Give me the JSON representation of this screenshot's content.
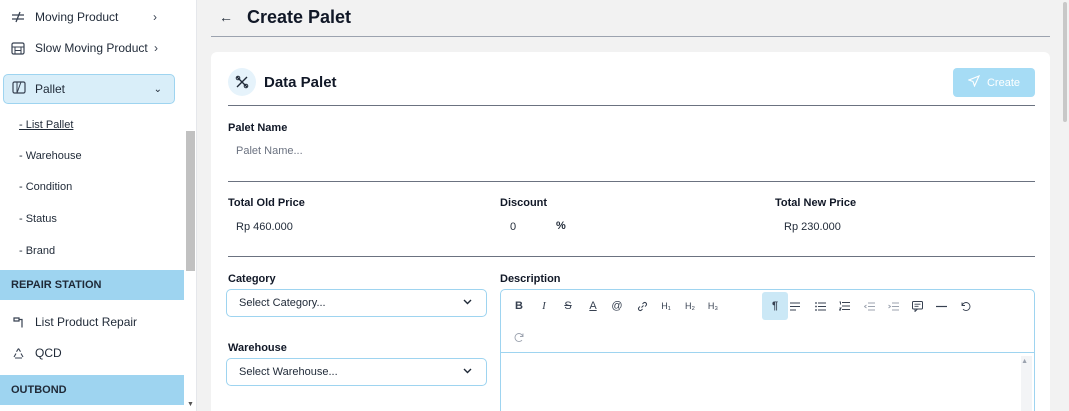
{
  "sidebar": {
    "items": [
      {
        "label": "Moving Product",
        "icon": "moving-icon"
      },
      {
        "label": "Slow Moving Product",
        "icon": "building-icon"
      },
      {
        "label": "Pallet",
        "icon": "pallet-icon"
      }
    ],
    "pallet_sub": [
      "- List Pallet",
      "- Warehouse",
      "- Condition",
      "- Status",
      "- Brand"
    ],
    "repair_section": "REPAIR STATION",
    "repair_items": [
      {
        "label": "List Product Repair",
        "icon": "repair-icon"
      },
      {
        "label": "QCD",
        "icon": "recycle-icon"
      }
    ],
    "outbond_section": "OUTBOND"
  },
  "header": {
    "title": "Create Palet"
  },
  "card": {
    "title": "Data Palet",
    "create_label": "Create",
    "palet_name_label": "Palet Name",
    "palet_name_placeholder": "Palet Name...",
    "total_old_price_label": "Total Old Price",
    "total_old_price_value": "Rp 460.000",
    "discount_label": "Discount",
    "discount_value": "0",
    "discount_unit": "%",
    "total_new_price_label": "Total New Price",
    "total_new_price_value": "Rp 230.000",
    "category_label": "Category",
    "category_value": "Select Category...",
    "warehouse_label": "Warehouse",
    "warehouse_value": "Select Warehouse...",
    "description_label": "Description"
  },
  "toolbar": {
    "buttons": [
      "B",
      "I",
      "S",
      "A",
      "@",
      "link",
      "H1",
      "H2",
      "H3",
      "¶",
      "align",
      "bullet",
      "ordered",
      "outdent",
      "indent",
      "comment",
      "hr",
      "undo",
      "redo"
    ]
  },
  "colors": {
    "accent": "#9ed4f0",
    "active_bg": "#d9eef9",
    "button_bg": "#a6dcf5"
  }
}
